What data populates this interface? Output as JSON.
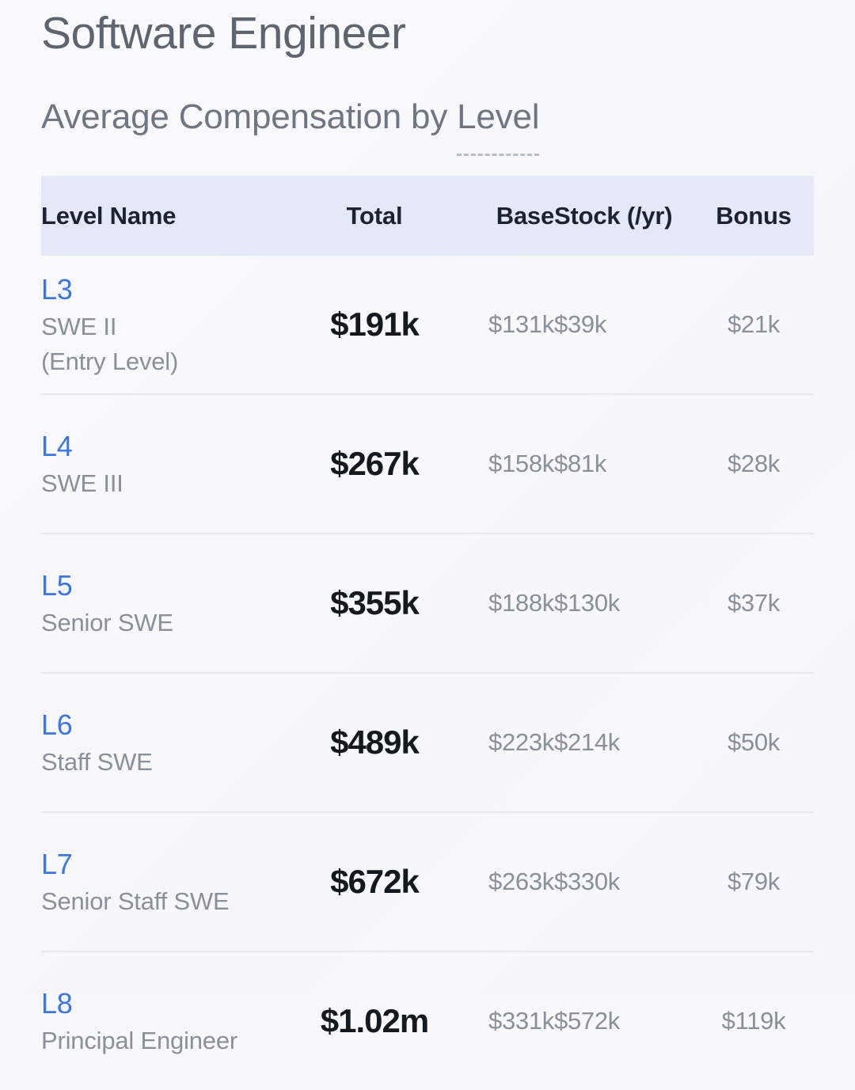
{
  "header": {
    "title": "Software Engineer",
    "subtitle_prefix": "Average Compensation by ",
    "subtitle_term": "Level"
  },
  "colors": {
    "page_background": "#f8f8fb",
    "table_header_background": "#e5e8f6",
    "table_header_text": "#1b2233",
    "link_blue": "#3b76e8",
    "muted_text": "#8a9099",
    "total_text": "#14181f",
    "title_text": "#5d6670",
    "row_divider": "#e7e8ee"
  },
  "table": {
    "columns": [
      {
        "key": "level",
        "label": "Level Name"
      },
      {
        "key": "total",
        "label": "Total"
      },
      {
        "key": "base",
        "label": "Base"
      },
      {
        "key": "stock",
        "label": "Stock (/yr)"
      },
      {
        "key": "bonus",
        "label": "Bonus"
      }
    ],
    "rows": [
      {
        "code": "L3",
        "name": "SWE II\n(Entry Level)",
        "name_line1": "SWE II",
        "name_line2": "(Entry Level)",
        "total": "$191k",
        "base": "$131k",
        "stock": "$39k",
        "bonus": "$21k"
      },
      {
        "code": "L4",
        "name": "SWE III",
        "name_line1": "SWE III",
        "name_line2": "",
        "total": "$267k",
        "base": "$158k",
        "stock": "$81k",
        "bonus": "$28k"
      },
      {
        "code": "L5",
        "name": "Senior SWE",
        "name_line1": "Senior SWE",
        "name_line2": "",
        "total": "$355k",
        "base": "$188k",
        "stock": "$130k",
        "bonus": "$37k"
      },
      {
        "code": "L6",
        "name": "Staff SWE",
        "name_line1": "Staff SWE",
        "name_line2": "",
        "total": "$489k",
        "base": "$223k",
        "stock": "$214k",
        "bonus": "$50k"
      },
      {
        "code": "L7",
        "name": "Senior Staff SWE",
        "name_line1": "Senior Staff SWE",
        "name_line2": "",
        "total": "$672k",
        "base": "$263k",
        "stock": "$330k",
        "bonus": "$79k"
      },
      {
        "code": "L8",
        "name": "Principal Engineer",
        "name_line1": "Principal Engineer",
        "name_line2": "",
        "total": "$1.02m",
        "base": "$331k",
        "stock": "$572k",
        "bonus": "$119k"
      }
    ]
  },
  "chart_data": {
    "type": "table",
    "title": "Software Engineer — Average Compensation by Level",
    "columns": [
      "Level Name",
      "Total",
      "Base",
      "Stock (/yr)",
      "Bonus"
    ],
    "categories": [
      "L3",
      "L4",
      "L5",
      "L6",
      "L7",
      "L8"
    ],
    "category_labels": [
      "L3 SWE II (Entry Level)",
      "L4 SWE III",
      "L5 Senior SWE",
      "L6 Staff SWE",
      "L7 Senior Staff SWE",
      "L8 Principal Engineer"
    ],
    "series": [
      {
        "name": "Total",
        "values": [
          191000,
          267000,
          355000,
          489000,
          672000,
          1020000
        ],
        "display": [
          "$191k",
          "$267k",
          "$355k",
          "$489k",
          "$672k",
          "$1.02m"
        ]
      },
      {
        "name": "Base",
        "values": [
          131000,
          158000,
          188000,
          223000,
          263000,
          331000
        ],
        "display": [
          "$131k",
          "$158k",
          "$188k",
          "$223k",
          "$263k",
          "$331k"
        ]
      },
      {
        "name": "Stock (/yr)",
        "values": [
          39000,
          81000,
          130000,
          214000,
          330000,
          572000
        ],
        "display": [
          "$39k",
          "$81k",
          "$130k",
          "$214k",
          "$330k",
          "$572k"
        ]
      },
      {
        "name": "Bonus",
        "values": [
          21000,
          28000,
          37000,
          50000,
          79000,
          119000
        ],
        "display": [
          "$21k",
          "$28k",
          "$37k",
          "$50k",
          "$79k",
          "$119k"
        ]
      }
    ],
    "currency": "USD",
    "units": "USD per year",
    "xlabel": "Level",
    "ylabel": "Average Compensation"
  }
}
